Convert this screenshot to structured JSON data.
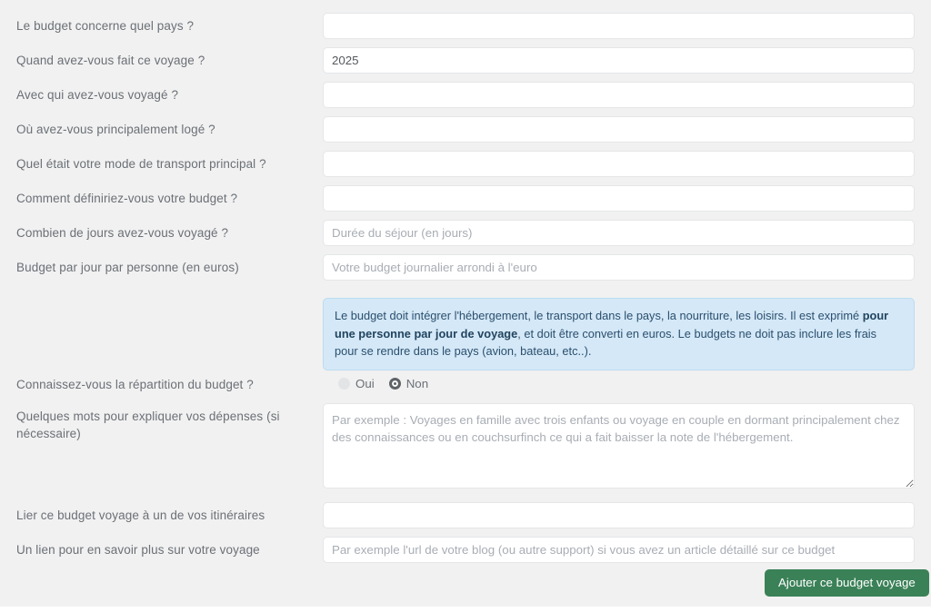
{
  "form": {
    "rows": [
      {
        "label": "Le budget concerne quel pays ?",
        "type": "text",
        "value": "",
        "placeholder": ""
      },
      {
        "label": "Quand avez-vous fait ce voyage ?",
        "type": "text",
        "value": "2025",
        "placeholder": ""
      },
      {
        "label": "Avec qui avez-vous voyagé ?",
        "type": "text",
        "value": "",
        "placeholder": ""
      },
      {
        "label": "Où avez-vous principalement logé ?",
        "type": "text",
        "value": "",
        "placeholder": ""
      },
      {
        "label": "Quel était votre mode de transport principal ?",
        "type": "text",
        "value": "",
        "placeholder": ""
      },
      {
        "label": "Comment définiriez-vous votre budget ?",
        "type": "text",
        "value": "",
        "placeholder": ""
      },
      {
        "label": "Combien de jours avez-vous voyagé ?",
        "type": "text",
        "value": "",
        "placeholder": "Durée du séjour (en jours)"
      },
      {
        "label": "Budget par jour par personne (en euros)",
        "type": "text",
        "value": "",
        "placeholder": "Votre budget journalier arrondi à l'euro"
      }
    ],
    "info_box": {
      "part1": "Le budget doit intégrer l'hébergement, le transport dans le pays, la nourriture, les loisirs. Il est exprimé ",
      "bold": "pour une personne par jour de voyage",
      "part2": ", et doit être converti en euros. Le budgets ne doit pas inclure les frais pour se rendre dans le pays (avion, bateau, etc..)."
    },
    "repartition": {
      "label": "Connaissez-vous la répartition du budget ?",
      "options": [
        {
          "label": "Oui",
          "checked": false
        },
        {
          "label": "Non",
          "checked": true
        }
      ]
    },
    "expenses": {
      "label": "Quelques mots pour expliquer vos dépenses (si nécessaire)",
      "value": "",
      "placeholder": "Par exemple : Voyages en famille avec trois enfants ou voyage en couple en dormant principalement chez des connaissances ou en couchsurfinch ce qui a fait baisser la note de l'hébergement."
    },
    "itinerary": {
      "label": "Lier ce budget voyage à un de vos itinéraires",
      "value": "",
      "placeholder": ""
    },
    "link": {
      "label": "Un lien pour en savoir plus sur votre voyage",
      "value": "",
      "placeholder": "Par exemple l'url de votre blog (ou autre support) si vous avez un article détaillé sur ce budget"
    },
    "submit_label": "Ajouter ce budget voyage"
  },
  "colors": {
    "page_background": "#f1f1f1",
    "field_background": "#ffffff",
    "field_border": "#e4e6e8",
    "label_text": "#6b7076",
    "placeholder_text": "#a8adb4",
    "info_background": "#d4e8f7",
    "info_border": "#bcdcf1",
    "info_text": "#2b4f6e",
    "submit_background": "#3b8158",
    "submit_text": "#ffffff"
  }
}
